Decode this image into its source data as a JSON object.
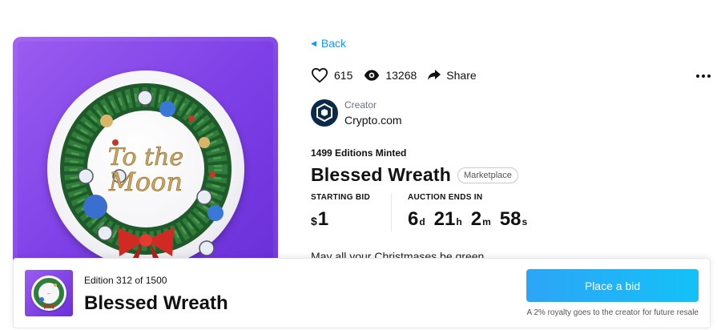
{
  "nav": {
    "back_label": "Back"
  },
  "stats": {
    "likes": "615",
    "views": "13268",
    "share_label": "Share"
  },
  "creator": {
    "role_label": "Creator",
    "name": "Crypto.com"
  },
  "nft": {
    "editions_minted": "1499 Editions Minted",
    "title": "Blessed Wreath",
    "badge": "Marketplace",
    "description": "May all your Christmases be green"
  },
  "auction": {
    "starting_bid_label": "STARTING BID",
    "currency": "$",
    "starting_bid": "1",
    "ends_label": "AUCTION ENDS IN",
    "days": "6",
    "days_unit": "d",
    "hours": "21",
    "hours_unit": "h",
    "minutes": "2",
    "minutes_unit": "m",
    "seconds": "58",
    "seconds_unit": "s"
  },
  "artwork": {
    "text_line1": "To the",
    "text_line2": "Moon"
  },
  "bottom_bar": {
    "edition": "Edition 312 of 1500",
    "title": "Blessed Wreath",
    "bid_button": "Place a bid",
    "royalty_note": "A 2% royalty goes to the creator for future resale"
  },
  "colors": {
    "accent": "#1199fa",
    "button_start": "#2da5f7",
    "button_end": "#14c1f7",
    "card_bg": "#7d3fe6"
  },
  "icons": [
    "heart-icon",
    "eye-icon",
    "share-icon",
    "more-icon",
    "back-arrow-icon",
    "crypto-com-logo"
  ]
}
